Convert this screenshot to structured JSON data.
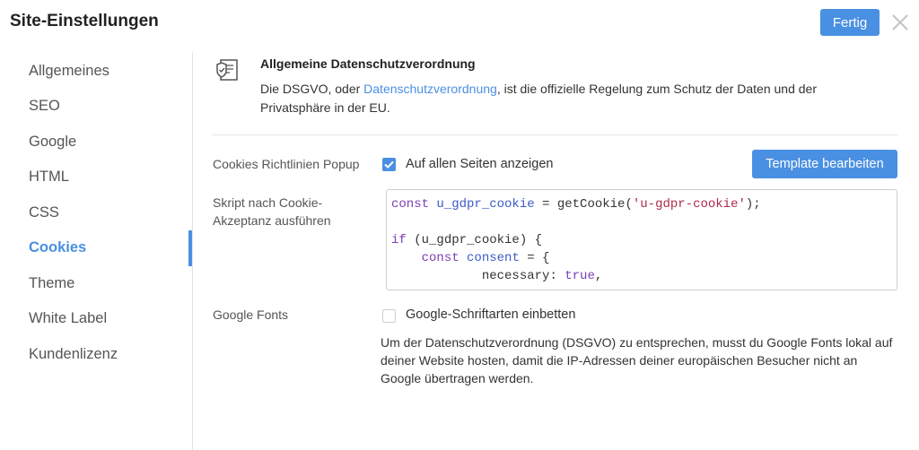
{
  "header": {
    "title": "Site-Einstellungen",
    "done_label": "Fertig"
  },
  "sidebar": {
    "items": [
      {
        "label": "Allgemeines"
      },
      {
        "label": "SEO"
      },
      {
        "label": "Google"
      },
      {
        "label": "HTML"
      },
      {
        "label": "CSS"
      },
      {
        "label": "Cookies",
        "active": true
      },
      {
        "label": "Theme"
      },
      {
        "label": "White Label"
      },
      {
        "label": "Kundenlizenz"
      }
    ]
  },
  "gdpr": {
    "title": "Allgemeine Datenschutzverordnung",
    "desc_before": "Die DSGVO, oder ",
    "desc_link": "Datenschutzverordnung",
    "desc_after": ", ist die offizielle Regelung zum Schutz der Daten und der Privatsphäre in der EU."
  },
  "cookies_popup": {
    "label": "Cookies Richtlinien Popup",
    "checkbox_label": "Auf allen Seiten anzeigen",
    "checked": true,
    "template_button": "Template bearbeiten"
  },
  "script": {
    "label_line1": "Skript nach Cookie-",
    "label_line2": "Akzeptanz ausführen",
    "code": {
      "l1_kw": "const",
      "l1_var": "u_gdpr_cookie",
      "l1_mid": " = getCookie(",
      "l1_str": "'u-gdpr-cookie'",
      "l1_end": ");",
      "l3_kw": "if",
      "l3_rest": " (u_gdpr_cookie) {",
      "l4_indent": "    ",
      "l4_kw": "const",
      "l4_var": "consent",
      "l4_rest": " = {",
      "l5_indent": "            ",
      "l5_key": "necessary: ",
      "l5_kw": "true",
      "l5_end": ","
    }
  },
  "google_fonts": {
    "label": "Google Fonts",
    "checkbox_label": "Google-Schriftarten einbetten",
    "checked": false,
    "description": "Um der Datenschutzverordnung (DSGVO) zu entsprechen, musst du Google Fonts lokal auf deiner Website hosten, damit die IP-Adressen deiner europäischen Besucher nicht an Google übertragen werden."
  },
  "colors": {
    "accent": "#4a90e2"
  },
  "icons": {
    "close": "close-icon",
    "gdpr": "shield-document-icon",
    "check": "checkmark-icon"
  }
}
